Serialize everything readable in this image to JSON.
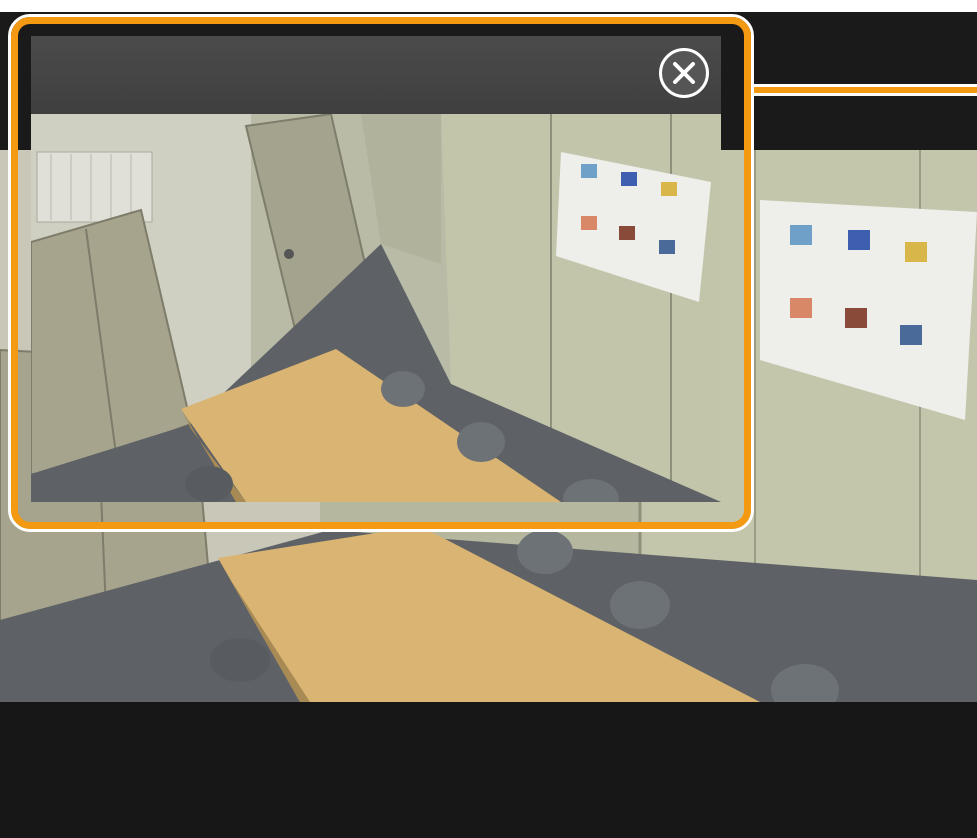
{
  "viewer": {
    "feed_description_icon": "meeting-room-camera-view",
    "accent_color": "#f39a12",
    "background_color": "#1a1a1a"
  },
  "popup": {
    "close_icon": "close-icon"
  }
}
